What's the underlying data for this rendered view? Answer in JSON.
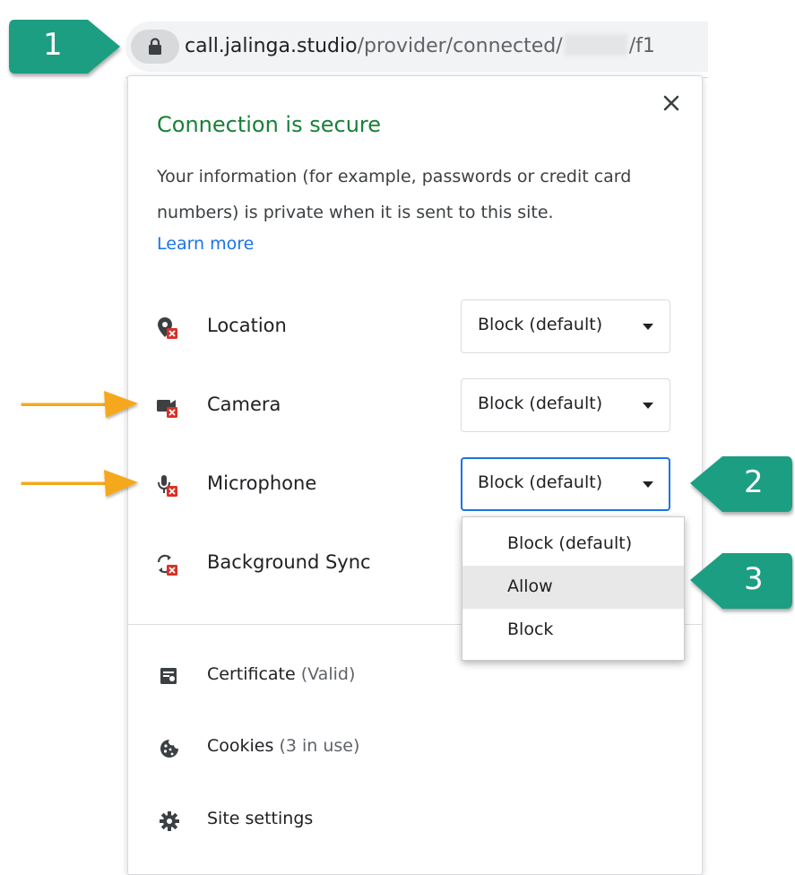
{
  "address_bar": {
    "url_host": "call.jalinga.studio",
    "url_path_prefix": "/provider/connected/",
    "url_path_suffix": "/f1"
  },
  "popup": {
    "title": "Connection is secure",
    "description": "Your information (for example, passwords or credit card numbers) is private when it is sent to this site.",
    "learn_more": "Learn more",
    "permissions": [
      {
        "label": "Location",
        "value": "Block (default)",
        "icon": "location-blocked-icon"
      },
      {
        "label": "Camera",
        "value": "Block (default)",
        "icon": "camera-blocked-icon"
      },
      {
        "label": "Microphone",
        "value": "Block (default)",
        "icon": "microphone-blocked-icon"
      },
      {
        "label": "Background Sync",
        "icon": "sync-blocked-icon"
      }
    ],
    "dropdown_options": [
      "Block (default)",
      "Allow",
      "Block"
    ],
    "highlighted_option": "Allow",
    "footer": {
      "certificate": {
        "label": "Certificate",
        "sub": "(Valid)"
      },
      "cookies": {
        "label": "Cookies",
        "sub": "(3 in use)"
      },
      "site_settings": {
        "label": "Site settings"
      }
    }
  },
  "annotations": {
    "callout_1": "1",
    "callout_2": "2",
    "callout_3": "3"
  },
  "colors": {
    "secure_green": "#188038",
    "link_blue": "#1a73e8",
    "callout_teal": "#1a9e83",
    "arrow_orange": "#f5a81f",
    "blocked_red": "#d93025"
  }
}
